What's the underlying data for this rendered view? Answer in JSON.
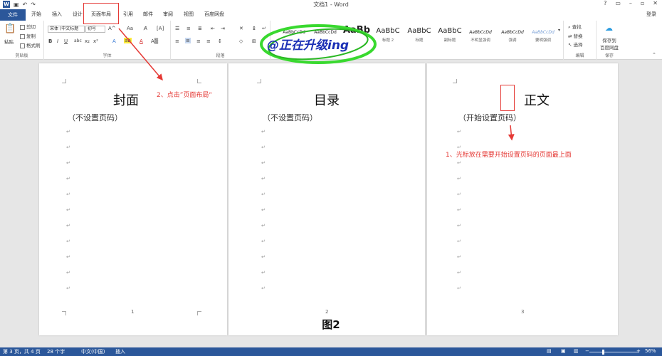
{
  "titlebar": {
    "title": "文档1 - Word",
    "word_icon": "W",
    "login": "登录"
  },
  "tabs": [
    "文件",
    "开始",
    "插入",
    "设计",
    "页面布局",
    "引用",
    "邮件",
    "审阅",
    "视图",
    "百度网盘"
  ],
  "ribbon": {
    "clipboard": {
      "cut": "剪切",
      "copy": "复制",
      "paste": "粘贴",
      "format_painter": "格式刷",
      "label": "剪贴板"
    },
    "font": {
      "font_name": "宋体 (中文标题",
      "font_size": "初号",
      "label": "字体"
    },
    "paragraph": {
      "label": "段落"
    },
    "styles": [
      {
        "sample": "AaBbCcDd",
        "name": ""
      },
      {
        "sample": "AaBbCcDd",
        "name": ""
      },
      {
        "sample": "AaBb",
        "name": ""
      },
      {
        "sample": "AaBbC",
        "name": "标题 2"
      },
      {
        "sample": "AaBbC",
        "name": "标题"
      },
      {
        "sample": "AaBbC",
        "name": "副标题"
      },
      {
        "sample": "AaBbCcDd",
        "name": "不明显强调"
      },
      {
        "sample": "AaBbCcDd",
        "name": "强调"
      },
      {
        "sample": "AaBbCcDd",
        "name": "要明强调"
      }
    ],
    "editing": {
      "find": "查找",
      "replace": "替换",
      "select": "选择",
      "label": "编辑"
    },
    "save": {
      "line1": "保存到",
      "line2": "百度网盘",
      "label": "保存"
    }
  },
  "pages": [
    {
      "title": "封面",
      "note": "（不设置页码）",
      "number": "1"
    },
    {
      "title": "目录",
      "note": "（不设置页码）",
      "number": "2"
    },
    {
      "title": "正文",
      "note": "（开始设置页码）",
      "number": "3"
    }
  ],
  "annotations": {
    "step2": "2、点击”页面布局“",
    "step1": "1、光标放在需要开始设置页码的页面最上面"
  },
  "watermark": "@正在升级ing",
  "caption": "图2",
  "status": {
    "page": "第 3 页，共 4 页",
    "words": "28 个字",
    "lang": "中文(中国)",
    "mode": "插入",
    "zoom": "56%"
  },
  "colors": {
    "accent": "#2b579a",
    "annotation": "#e53935",
    "watermark_outline": "#39d92f"
  }
}
